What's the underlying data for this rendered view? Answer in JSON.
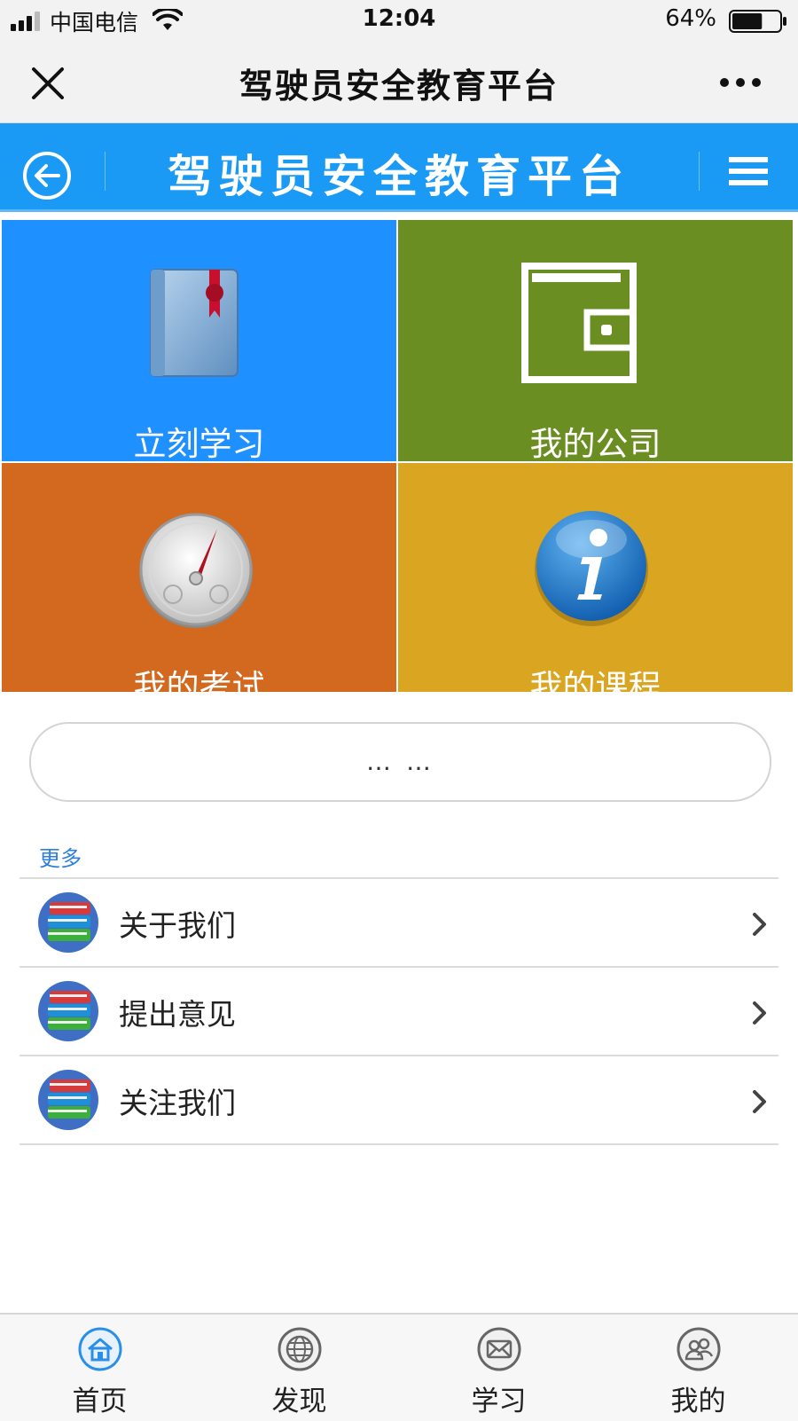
{
  "status_bar": {
    "carrier": "中国电信",
    "time": "12:04",
    "battery_percent": "64%",
    "battery_level": 0.64
  },
  "wechat_nav": {
    "title": "驾驶员安全教育平台"
  },
  "app_header": {
    "title": "驾驶员安全教育平台"
  },
  "tiles": [
    {
      "label": "立刻学习",
      "icon": "book-bookmark-icon",
      "color": "#1e90ff"
    },
    {
      "label": "我的公司",
      "icon": "wallet-icon",
      "color": "#6b8e23"
    },
    {
      "label": "我的考试",
      "icon": "compass-gauge-icon",
      "color": "#d2691e"
    },
    {
      "label": "我的课程",
      "icon": "info-icon",
      "color": "#daa520"
    }
  ],
  "pill": {
    "text": "… …"
  },
  "more": {
    "heading": "更多",
    "items": [
      {
        "label": "关于我们",
        "icon": "books-icon"
      },
      {
        "label": "提出意见",
        "icon": "books-icon"
      },
      {
        "label": "关注我们",
        "icon": "books-icon"
      }
    ]
  },
  "tabbar": {
    "tabs": [
      {
        "label": "首页",
        "icon": "home-icon",
        "active": true
      },
      {
        "label": "发现",
        "icon": "globe-icon",
        "active": false
      },
      {
        "label": "学习",
        "icon": "mail-icon",
        "active": false
      },
      {
        "label": "我的",
        "icon": "users-icon",
        "active": false
      }
    ]
  },
  "colors": {
    "header": "#1a9af5",
    "link": "#2f7fdc"
  }
}
